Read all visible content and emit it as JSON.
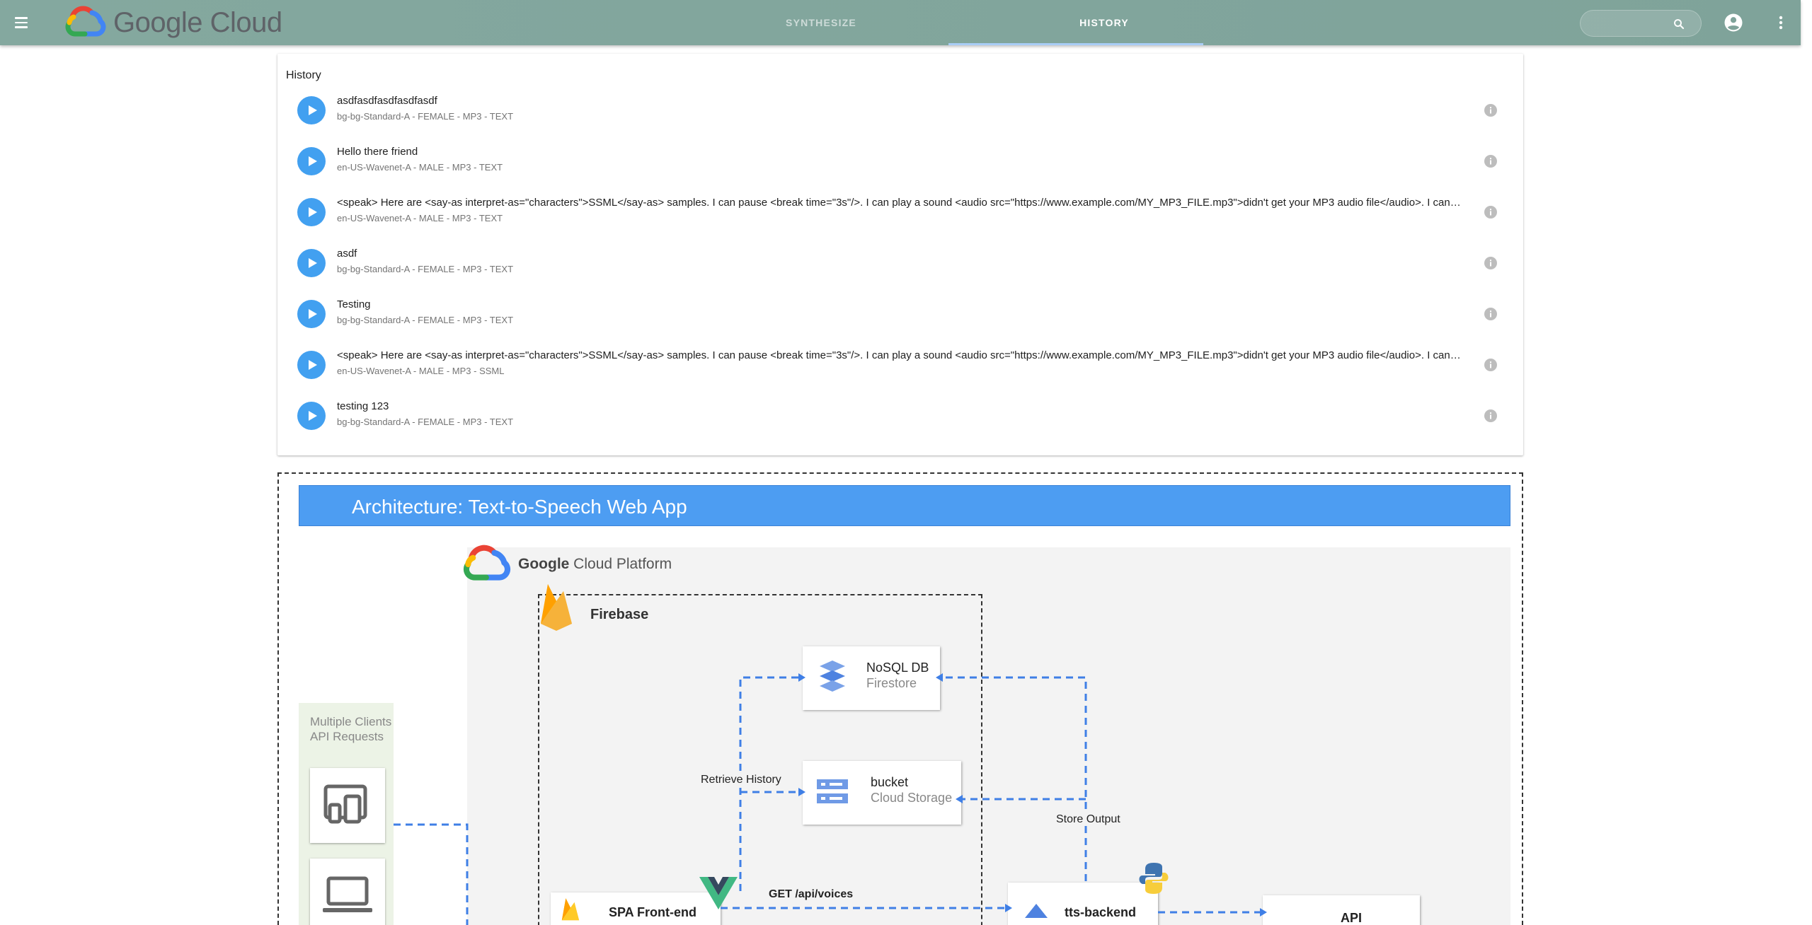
{
  "app": {
    "logo_text": "Google Cloud",
    "tabs": [
      {
        "label": "SYNTHESIZE",
        "active": false
      },
      {
        "label": "HISTORY",
        "active": true
      }
    ],
    "search": {
      "placeholder": "",
      "value": ""
    },
    "icons": {
      "menu": "menu-icon",
      "search": "search-icon",
      "account": "account-circle-icon",
      "more": "more-vert-icon"
    }
  },
  "history": {
    "title": "History",
    "items": [
      {
        "title": "asdfasdfasdfasdfasdf",
        "subtitle": "bg-bg-Standard-A - FEMALE - MP3 - TEXT"
      },
      {
        "title": "Hello there friend",
        "subtitle": "en-US-Wavenet-A - MALE - MP3 - TEXT"
      },
      {
        "title": "<speak> Here are <say-as interpret-as=\"characters\">SSML</say-as> samples. I can pause <break time=\"3s\"/>. I can play a sound <audio src=\"https://www.example.com/MY_MP3_FILE.mp3\">didn't get your MP3 audio file</audio>. I can speak in cardinals.",
        "subtitle": "en-US-Wavenet-A - MALE - MP3 - TEXT"
      },
      {
        "title": "asdf",
        "subtitle": "bg-bg-Standard-A - FEMALE - MP3 - TEXT"
      },
      {
        "title": "Testing",
        "subtitle": "bg-bg-Standard-A - FEMALE - MP3 - TEXT"
      },
      {
        "title": "<speak> Here are <say-as interpret-as=\"characters\">SSML</say-as> samples. I can pause <break time=\"3s\"/>. I can play a sound <audio src=\"https://www.example.com/MY_MP3_FILE.mp3\">didn't get your MP3 audio file</audio>. I can speak in cardinals.",
        "subtitle": "en-US-Wavenet-A - MALE - MP3 - SSML"
      },
      {
        "title": "testing 123",
        "subtitle": "bg-bg-Standard-A - FEMALE - MP3 - TEXT"
      }
    ]
  },
  "architecture": {
    "banner": "Architecture: Text-to-Speech Web App",
    "gcp_label_bold": "Google",
    "gcp_label_rest": " Cloud Platform",
    "firebase_label": "Firebase",
    "clients_label": "Multiple Clients API Requests",
    "nosql": {
      "name": "NoSQL DB",
      "sub": "Firestore"
    },
    "bucket": {
      "name": "bucket",
      "sub": "Cloud Storage"
    },
    "spa": {
      "name": "SPA Front-end"
    },
    "backend": {
      "name": "tts-backend"
    },
    "api": {
      "name": "API"
    },
    "edges": {
      "retrieve_history": "Retrieve History",
      "store_output": "Store Output",
      "get_voices": "GET /api/voices"
    }
  },
  "colors": {
    "appbar": "#84a89f",
    "play_button": "#42a0f0",
    "banner": "#4d9df2",
    "wire": "#3f7fe6"
  }
}
